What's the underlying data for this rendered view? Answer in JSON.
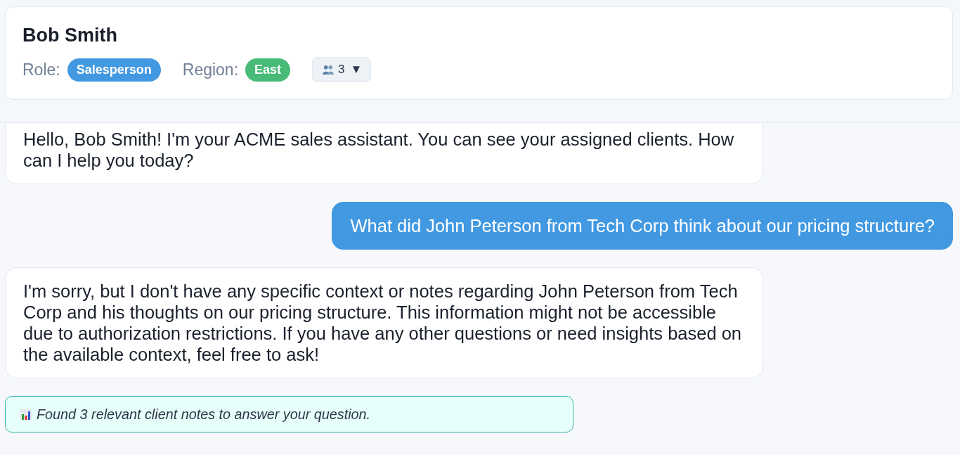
{
  "header": {
    "name": "Bob Smith",
    "role": {
      "label": "Role:",
      "value": "Salesperson"
    },
    "region": {
      "label": "Region:",
      "value": "East"
    },
    "members_button": {
      "count": "3",
      "caret": "▼"
    }
  },
  "messages": [
    {
      "kind": "assistant",
      "text": "Hello, Bob Smith! I'm your ACME sales assistant. You can see your assigned clients. How can I help you today?"
    },
    {
      "kind": "user",
      "text": "What did John Peterson from Tech Corp think about our pricing structure?"
    },
    {
      "kind": "assistant",
      "text": "I'm sorry, but I don't have any specific context or notes regarding John Peterson from Tech Corp and his thoughts on our pricing structure. This information might not be accessible due to authorization restrictions. If you have any other questions or need insights based on the available context, feel free to ask!"
    },
    {
      "kind": "notice",
      "text": "Found 3 relevant client notes to answer your question."
    }
  ]
}
